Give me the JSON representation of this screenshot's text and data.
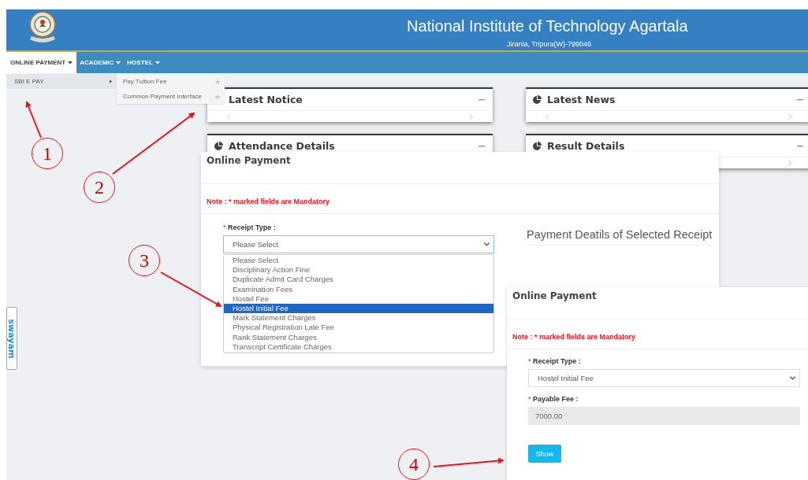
{
  "header": {
    "title": "National Institute of Technology Agartala",
    "subtitle": "Jirania, Tripura(W)-799046"
  },
  "nav": [
    {
      "label": "ONLINE PAYMENT",
      "selected": true
    },
    {
      "label": "ACADEMIC",
      "selected": false
    },
    {
      "label": "HOSTEL",
      "selected": false
    }
  ],
  "menu": {
    "items": [
      {
        "label": "SBI E PAY",
        "selected": true
      }
    ],
    "submenu": [
      {
        "label": "Pay Tuition Fee"
      },
      {
        "label": "Common Payment Interface"
      }
    ]
  },
  "cards": [
    {
      "title": "Latest Notice",
      "icon": false,
      "prev_arrow": true,
      "next_arrow": true
    },
    {
      "title": "Latest News",
      "icon": true,
      "prev_arrow": true,
      "next_arrow": true
    },
    {
      "title": "Attendance Details",
      "icon": true,
      "prev_arrow": false,
      "next_arrow": false
    },
    {
      "title": "Result Details",
      "icon": true,
      "prev_arrow": false,
      "next_arrow": true
    }
  ],
  "side_tab": {
    "label": "swayam"
  },
  "payment_form": {
    "title": "Online Payment",
    "note": "Note : * marked fields are Mandatory",
    "required_mark": "*",
    "field_label": "Receipt Type :",
    "select_value": "Please Select",
    "details_heading": "Payment Deatils of Selected Receipt",
    "options": [
      {
        "label": "Please Select",
        "selected": false
      },
      {
        "label": "Disciplinary Action Fine",
        "selected": false
      },
      {
        "label": "Duplicate Admit Card Charges",
        "selected": false
      },
      {
        "label": "Examination Fees",
        "selected": false
      },
      {
        "label": "Hostel Fee",
        "selected": false
      },
      {
        "label": "Hostel Initial Fee",
        "selected": true
      },
      {
        "label": "Mark Statement Charges",
        "selected": false
      },
      {
        "label": "Physical Registration Late Fee",
        "selected": false
      },
      {
        "label": "Rank Statement Charges",
        "selected": false
      },
      {
        "label": "Transcript Certificate Charges",
        "selected": false
      }
    ]
  },
  "payment_result": {
    "title": "Online Payment",
    "note": "Note : * marked fields are Mandatory",
    "button": "Show",
    "fields": [
      {
        "kind": "select",
        "required_mark": "*",
        "label": "Receipt Type :",
        "value": "Hostel Initial Fee"
      },
      {
        "kind": "readonly",
        "required_mark": "*",
        "label": "Payable Fee :",
        "value": "7000.00"
      }
    ]
  },
  "annotations": [
    {
      "label": "1"
    },
    {
      "label": "2"
    },
    {
      "label": "3"
    },
    {
      "label": "4"
    }
  ]
}
